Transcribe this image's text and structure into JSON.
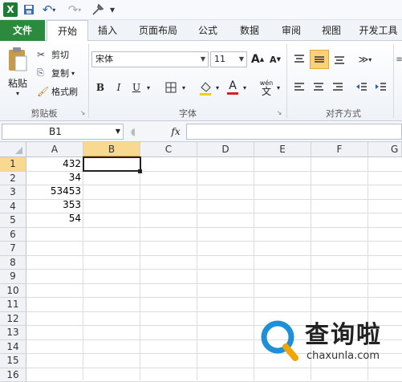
{
  "qat": {
    "excel_icon": "X",
    "save_icon": "💾",
    "undo_icon": "↶",
    "redo_icon": "↷",
    "more": "▾"
  },
  "tabs": [
    "文件",
    "开始",
    "插入",
    "页面布局",
    "公式",
    "数据",
    "审阅",
    "视图",
    "开发工具"
  ],
  "active_tab": "开始",
  "clipboard": {
    "paste": "粘贴",
    "cut": "剪切",
    "copy": "复制",
    "format_painter": "格式刷",
    "label": "剪贴板"
  },
  "font": {
    "name": "宋体",
    "size": "11",
    "label": "字体",
    "bold": "B",
    "italic": "I",
    "underline": "U",
    "grow": "A",
    "shrink": "A",
    "color_letter": "A",
    "wen": "wén",
    "wen_char": "文"
  },
  "alignment": {
    "label": "对齐方式"
  },
  "formula_bar": {
    "name_box": "B1",
    "fx": "fx",
    "value": ""
  },
  "columns": [
    "A",
    "B",
    "C",
    "D",
    "E",
    "F",
    "G"
  ],
  "selected_column": "B",
  "rows": [
    "1",
    "2",
    "3",
    "4",
    "5",
    "6",
    "7",
    "8",
    "9",
    "10",
    "11",
    "12",
    "13",
    "14",
    "15",
    "16"
  ],
  "selected_row": "1",
  "cells_a": [
    "432",
    "34",
    "53453",
    "353",
    "54"
  ],
  "watermark": {
    "brand": "查询啦",
    "url": "chaxunla.com",
    "accent": "#1f8fd8"
  }
}
